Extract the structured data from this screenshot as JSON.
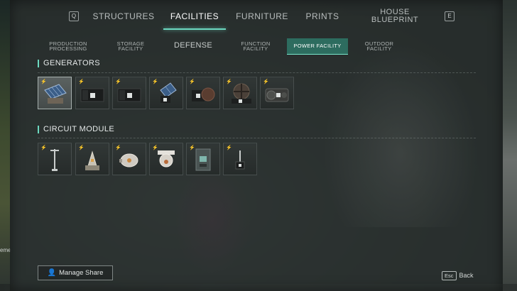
{
  "top_tabs": {
    "key_left": "Q",
    "key_right": "E",
    "items": [
      {
        "label": "STRUCTURES"
      },
      {
        "label": "FACILITIES",
        "active": true
      },
      {
        "label": "FURNITURE"
      },
      {
        "label": "PRINTS"
      },
      {
        "label_line1": "HOUSE",
        "label_line2": "BLUEPRINT"
      }
    ]
  },
  "sub_tabs": [
    {
      "line1": "PRODUCTION",
      "line2": "PROCESSING"
    },
    {
      "line1": "STORAGE",
      "line2": "FACILITY"
    },
    {
      "line1": "DEFENSE"
    },
    {
      "line1": "FUNCTION",
      "line2": "FACILITY"
    },
    {
      "line1": "POWER FACILITY",
      "active": true
    },
    {
      "line1": "OUTDOOR",
      "line2": "FACILITY"
    }
  ],
  "sections": {
    "generators": {
      "title": "GENERATORS",
      "items": [
        {
          "icon": "solar-panel-icon",
          "selected": true
        },
        {
          "icon": "generator-icon"
        },
        {
          "icon": "generator-icon"
        },
        {
          "icon": "solar-panel-icon"
        },
        {
          "icon": "wood-burner-generator-icon"
        },
        {
          "icon": "wind-turbine-generator-icon"
        },
        {
          "icon": "fuel-generator-icon"
        }
      ]
    },
    "circuit_module": {
      "title": "CIRCUIT MODULE",
      "items": [
        {
          "icon": "lamp-post-icon"
        },
        {
          "icon": "transformer-icon"
        },
        {
          "icon": "power-node-icon"
        },
        {
          "icon": "ceiling-node-icon"
        },
        {
          "icon": "electric-box-icon"
        },
        {
          "icon": "switch-icon"
        }
      ]
    }
  },
  "footer": {
    "manage_share": "Manage Share",
    "esc_key": "Esc",
    "back": "Back",
    "side_text": "eme"
  },
  "colors": {
    "accent": "#6cd9c0",
    "active_tab_bg": "#2d6c5f"
  }
}
